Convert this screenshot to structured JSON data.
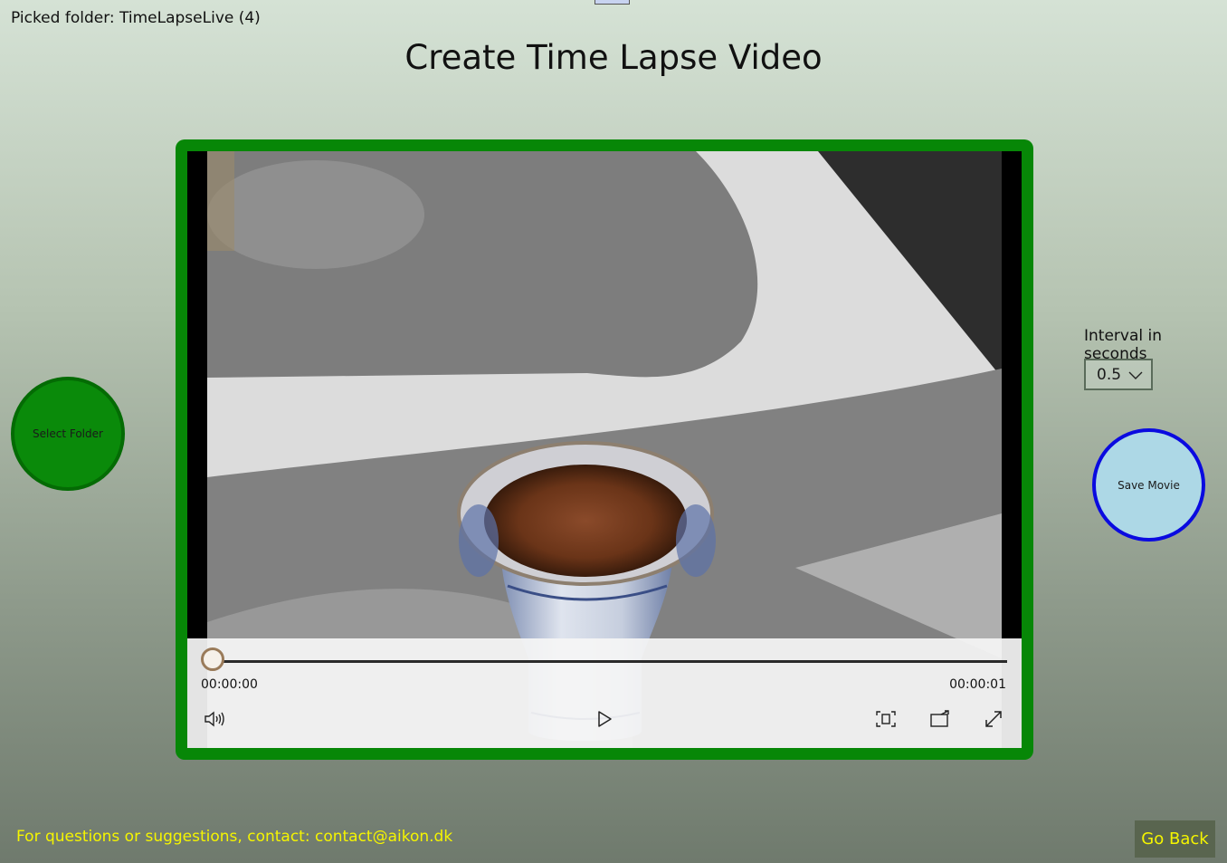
{
  "header": {
    "picked_folder": "Picked folder: TimeLapseLive (4)",
    "title": "Create Time Lapse Video"
  },
  "left_panel": {
    "select_folder_label": "Select Folder"
  },
  "player": {
    "current_time": "00:00:00",
    "total_time": "00:00:01",
    "progress": 0,
    "icons": [
      "volume-icon",
      "play-icon",
      "zoom-fit-icon",
      "cast-icon",
      "fullscreen-icon"
    ]
  },
  "right_panel": {
    "interval_label": "Interval in seconds",
    "interval_value": "0.5",
    "save_movie_label": "Save Movie"
  },
  "footer": {
    "contact": "For questions or suggestions, contact: contact@aikon.dk",
    "go_back_label": "Go Back"
  },
  "colors": {
    "frame_green": "#078707",
    "select_button": "#0a8a0a",
    "save_button_fill": "#add8e6",
    "save_button_border": "#0a0ae0",
    "footer_text": "#f5f500"
  }
}
